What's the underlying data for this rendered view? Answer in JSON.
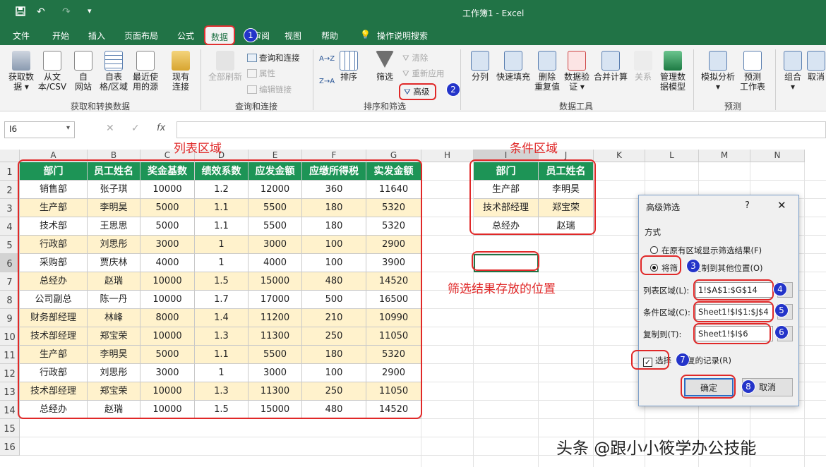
{
  "titlebar": {
    "save_icon": "save-icon",
    "undo": "↶",
    "redo": "↷",
    "more": "▾",
    "title": "工作簿1 - Excel"
  },
  "tabs": [
    "文件",
    "开始",
    "插入",
    "页面布局",
    "公式",
    "数据",
    "审阅",
    "视图",
    "帮助",
    "操作说明搜索"
  ],
  "active_tab": "数据",
  "ribbon": {
    "get_data": "获取数\n据 ▾",
    "from_csv": "从文\n本/CSV",
    "from_web": "自\n网站",
    "from_table": "自表\n格/区域",
    "recent_sources": "最近使\n用的源",
    "existing_conn": "现有\n连接",
    "group_get": "获取和转换数据",
    "refresh_all": "全部刷新",
    "queries_conn": "查询和连接",
    "properties": "属性",
    "edit_links": "编辑链接",
    "group_query": "查询和连接",
    "sort_az": "A→Z",
    "sort_za": "Z→A",
    "sort": "排序",
    "filter": "筛选",
    "clear": "清除",
    "reapply": "重新应用",
    "advanced": "高级",
    "group_sort": "排序和筛选",
    "split": "分列",
    "flash_fill": "快速填充",
    "remove_dup": "删除\n重复值",
    "validation": "数据验\n证 ▾",
    "consolidate": "合并计算",
    "relations": "关系",
    "data_model": "管理数\n据模型",
    "group_tools": "数据工具",
    "whatif": "模拟分析\n▾",
    "forecast": "预测\n工作表",
    "group_forecast": "预测",
    "group": "组合\n▾",
    "ungroup": "取消"
  },
  "formula_bar": {
    "name_box": "I6",
    "cancel": "✕",
    "enter": "✓",
    "fx": "fx",
    "value": ""
  },
  "columns": [
    "A",
    "B",
    "C",
    "D",
    "E",
    "F",
    "G",
    "H",
    "I",
    "J",
    "K",
    "L",
    "M",
    "N"
  ],
  "rows": [
    "1",
    "2",
    "3",
    "4",
    "5",
    "6",
    "7",
    "8",
    "9",
    "10",
    "11",
    "12",
    "13",
    "14",
    "15",
    "16"
  ],
  "list_range": {
    "headers": [
      "部门",
      "员工姓名",
      "奖金基数",
      "绩效系数",
      "应发金额",
      "应缴所得税",
      "实发金额"
    ],
    "rows": [
      [
        "销售部",
        "张子琪",
        "10000",
        "1.2",
        "12000",
        "360",
        "11640"
      ],
      [
        "生产部",
        "李明昊",
        "5000",
        "1.1",
        "5500",
        "180",
        "5320"
      ],
      [
        "技术部",
        "王思思",
        "5000",
        "1.1",
        "5500",
        "180",
        "5320"
      ],
      [
        "行政部",
        "刘思彤",
        "3000",
        "1",
        "3000",
        "100",
        "2900"
      ],
      [
        "采购部",
        "贾庆林",
        "4000",
        "1",
        "4000",
        "100",
        "3900"
      ],
      [
        "总经办",
        "赵瑞",
        "10000",
        "1.5",
        "15000",
        "480",
        "14520"
      ],
      [
        "公司副总",
        "陈一丹",
        "10000",
        "1.7",
        "17000",
        "500",
        "16500"
      ],
      [
        "财务部经理",
        "林峰",
        "8000",
        "1.4",
        "11200",
        "210",
        "10990"
      ],
      [
        "技术部经理",
        "郑宝荣",
        "10000",
        "1.3",
        "11300",
        "250",
        "11050"
      ],
      [
        "生产部",
        "李明昊",
        "5000",
        "1.1",
        "5500",
        "180",
        "5320"
      ],
      [
        "行政部",
        "刘思彤",
        "3000",
        "1",
        "3000",
        "100",
        "2900"
      ],
      [
        "技术部经理",
        "郑宝荣",
        "10000",
        "1.3",
        "11300",
        "250",
        "11050"
      ],
      [
        "总经办",
        "赵瑞",
        "10000",
        "1.5",
        "15000",
        "480",
        "14520"
      ]
    ]
  },
  "criteria_range": {
    "headers": [
      "部门",
      "员工姓名"
    ],
    "rows": [
      [
        "生产部",
        "李明昊"
      ],
      [
        "技术部经理",
        "郑宝荣"
      ],
      [
        "总经办",
        "赵瑞"
      ]
    ]
  },
  "annotations": {
    "list_label": "列表区域",
    "criteria_label": "条件区域",
    "output_label": "筛选结果存放的位置",
    "watermark": "头条 @跟小小筱学办公技能"
  },
  "badges": [
    "1",
    "2",
    "3",
    "4",
    "5",
    "6",
    "7",
    "8"
  ],
  "dialog": {
    "title": "高级筛选",
    "help": "?",
    "close": "✕",
    "section": "方式",
    "opt_inplace": "在原有区域显示筛选结果(F)",
    "opt_copy_prefix": "将筛",
    "opt_copy_suffix": "复制到其他位置(O)",
    "list_label": "列表区域(L):",
    "list_value": "1!$A$1:$G$14",
    "criteria_label": "条件区域(C):",
    "criteria_value": "Sheet1!$I$1:$J$4",
    "copyto_label": "复制到(T):",
    "copyto_value": "Sheet1!$I$6",
    "unique_prefix": "选择",
    "unique_suffix": "复的记录(R)",
    "ok": "确定",
    "cancel": "取消"
  },
  "colors": {
    "excel_green": "#217346",
    "header_fill": "#1d9456",
    "zebra": "#fff2cc",
    "annotation_red": "#e02828",
    "badge_blue": "#2434c9"
  }
}
